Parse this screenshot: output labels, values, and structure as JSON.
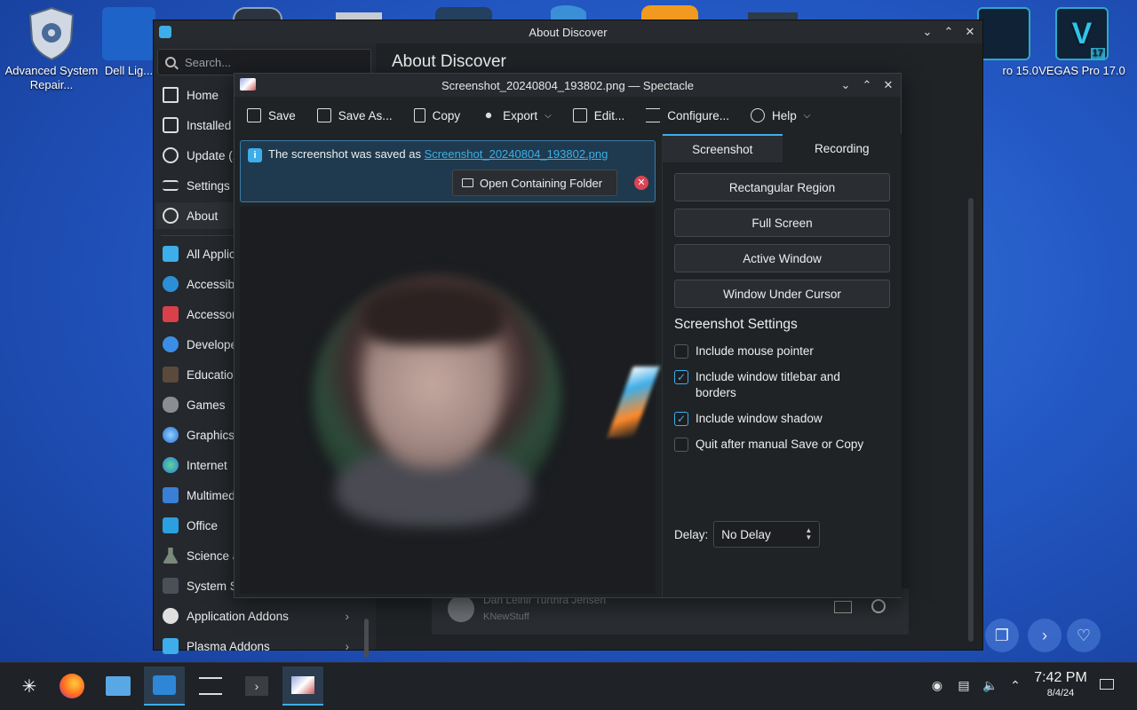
{
  "desktop": {
    "icons": [
      {
        "label": "Advanced System Repair..."
      },
      {
        "label": "Dell Lig..."
      },
      {
        "label": "ro 15.0"
      },
      {
        "label": "VEGAS Pro 17.0"
      }
    ]
  },
  "discover": {
    "window_title": "About Discover",
    "search_placeholder": "Search...",
    "page_title": "About Discover",
    "nav": [
      {
        "label": "Home"
      },
      {
        "label": "Installed"
      },
      {
        "label": "Update (1"
      },
      {
        "label": "Settings"
      },
      {
        "label": "About"
      },
      {
        "label": "All Applic"
      },
      {
        "label": "Accessibi"
      },
      {
        "label": "Accessor"
      },
      {
        "label": "Develope"
      },
      {
        "label": "Education"
      },
      {
        "label": "Games"
      },
      {
        "label": "Graphics"
      },
      {
        "label": "Internet"
      },
      {
        "label": "Multimed"
      },
      {
        "label": "Office"
      },
      {
        "label": "Science a"
      },
      {
        "label": "System S"
      },
      {
        "label": "Application Addons"
      },
      {
        "label": "Plasma Addons"
      }
    ],
    "credit": {
      "name": "Dan Leinir Turthra Jensen",
      "sub": "KNewStuff"
    }
  },
  "spectacle": {
    "window_title": "Screenshot_20240804_193802.png — Spectacle",
    "toolbar": {
      "save": "Save",
      "save_as": "Save As...",
      "copy": "Copy",
      "export": "Export",
      "edit": "Edit...",
      "configure": "Configure...",
      "help": "Help"
    },
    "notice": {
      "message": "The screenshot was saved as",
      "filename": "Screenshot_20240804_193802.png",
      "open_folder": "Open Containing Folder"
    },
    "tabs": {
      "screenshot": "Screenshot",
      "recording": "Recording"
    },
    "modes": {
      "rect": "Rectangular Region",
      "full": "Full Screen",
      "active": "Active Window",
      "under_cursor": "Window Under Cursor"
    },
    "settings": {
      "title": "Screenshot Settings",
      "mouse_pointer": {
        "label": "Include mouse pointer",
        "checked": false
      },
      "titlebar": {
        "label": "Include window titlebar and borders",
        "checked": true
      },
      "shadow": {
        "label": "Include window shadow",
        "checked": true
      },
      "quit": {
        "label": "Quit after manual Save or Copy",
        "checked": false
      },
      "delay_label": "Delay:",
      "delay_value": "No Delay"
    }
  },
  "taskbar": {
    "clock_time": "7:42 PM",
    "clock_date": "8/4/24"
  },
  "colors": {
    "accent": "#3daee9",
    "window_bg": "#202326",
    "notice_bg": "#1f3a4e",
    "close_red": "#da4453"
  }
}
